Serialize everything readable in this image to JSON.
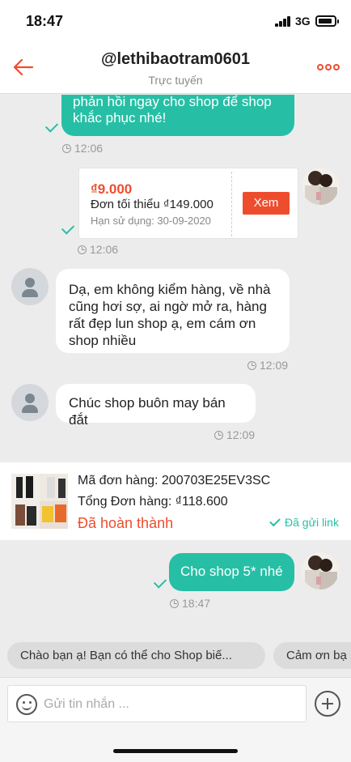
{
  "status_bar": {
    "time": "18:47",
    "network": "3G"
  },
  "header": {
    "title": "@lethibaotram0601",
    "subtitle": "Trực tuyến"
  },
  "messages": {
    "m1": {
      "text": "phản hồi ngay cho shop để shop khắc phục nhé!",
      "time": "12:06"
    },
    "voucher": {
      "amount": "₫9.000",
      "min_order": "Đơn tối thiểu ₫149.000",
      "expiry": "Hạn sử dụng: 30-09-2020",
      "button": "Xem",
      "time": "12:06"
    },
    "m2": {
      "text": "Dạ, em không kiểm hàng, về nhà cũng hơi sợ, ai ngờ mở ra, hàng rất đẹp lun shop ạ, em cám ơn shop nhiều",
      "time": "12:09"
    },
    "m3": {
      "text": "Chúc shop buôn may bán đắt",
      "time": "12:09"
    },
    "order": {
      "code": "Mã đơn hàng: 200703E25EV3SC",
      "total": "Tổng Đơn hàng: ₫118.600",
      "status": "Đã hoàn thành",
      "link": "Đã gửi link"
    },
    "m4": {
      "text": "Cho shop 5* nhé",
      "time": "18:47"
    }
  },
  "quick_replies": [
    "Chào bạn ạ! Bạn có thể cho Shop biế...",
    "Cảm ơn bạ"
  ],
  "input": {
    "placeholder": "Gửi tin nhắn ..."
  },
  "colors": {
    "accent": "#ee4d2d",
    "bubble": "#26bfa5"
  }
}
